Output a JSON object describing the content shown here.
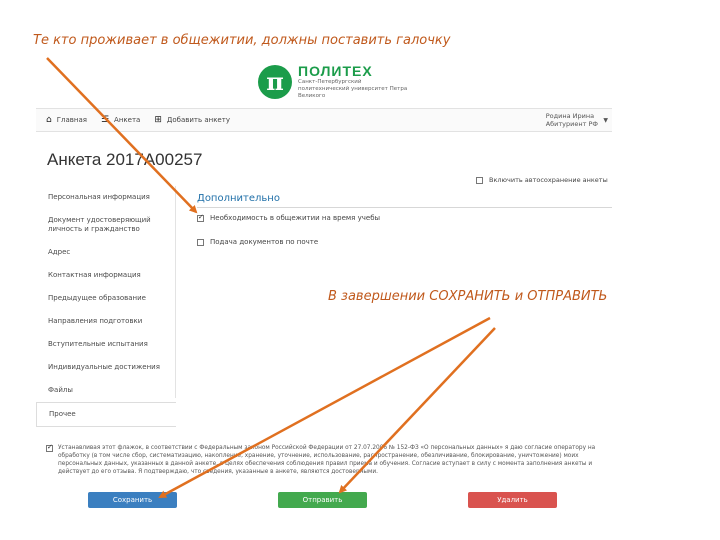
{
  "annotations": {
    "top": "Те кто проживает в общежитии, должны поставить галочку",
    "middle": "В завершении СОХРАНИТЬ и ОТПРАВИТЬ"
  },
  "logo": {
    "mark": "π",
    "title": "ПОЛИТЕХ",
    "subtitle": "Санкт-Петербургский политехнический университет Петра Великого"
  },
  "navbar": {
    "items": [
      {
        "icon": "home-icon",
        "glyph": "⌂",
        "label": "Главная"
      },
      {
        "icon": "list-icon",
        "glyph": "☰",
        "label": "Анкета"
      },
      {
        "icon": "plus-icon",
        "glyph": "⊞",
        "label": "Добавить анкету"
      }
    ],
    "user_line1": "Родина Ирина",
    "user_line2": "Абитуриент РФ"
  },
  "page": {
    "title": "Анкета 2017А00257"
  },
  "sidebar": {
    "items": [
      "Персональная информация",
      "Документ удостоверяющий личность и гражданство",
      "Адрес",
      "Контактная информация",
      "Предыдущее образование",
      "Направления подготовки",
      "Вступительные испытания",
      "Индивидуальные достижения",
      "Файлы",
      "Прочее"
    ],
    "active_index": 9
  },
  "autosave": {
    "label": "Включить автосохранение анкеты",
    "checked": false
  },
  "section": {
    "title": "Дополнительно",
    "options": [
      {
        "label": "Необходимость в общежитии на время учебы",
        "checked": true
      },
      {
        "label": "Подача документов по почте",
        "checked": false
      }
    ]
  },
  "consent": {
    "checked": true,
    "text": "Устанавливая этот флажок, в соответствии с Федеральным законом Российской Федерации от 27.07.2006 № 152-ФЗ «О персональных данных» я даю согласие оператору на обработку (в том числе сбор, систематизацию, накопление, хранение, уточнение, использование, распространение, обезличивание, блокирование, уничтожение) моих персональных данных, указанных в данной анкете, в целях обеспечения соблюдения правил приема и обучения. Согласие вступает в силу с момента заполнения анкеты и действует до его отзыва. Я подтверждаю, что сведения, указанные в анкете, являются достоверными."
  },
  "buttons": {
    "save": "Сохранить",
    "send": "Отправить",
    "delete": "Удалить"
  },
  "colors": {
    "annotation": "#c0591c",
    "brand_green": "#1b9c4a",
    "section_blue": "#1f6fa8",
    "save": "#3b7fc0",
    "send": "#43a94e",
    "delete": "#d9534f"
  }
}
